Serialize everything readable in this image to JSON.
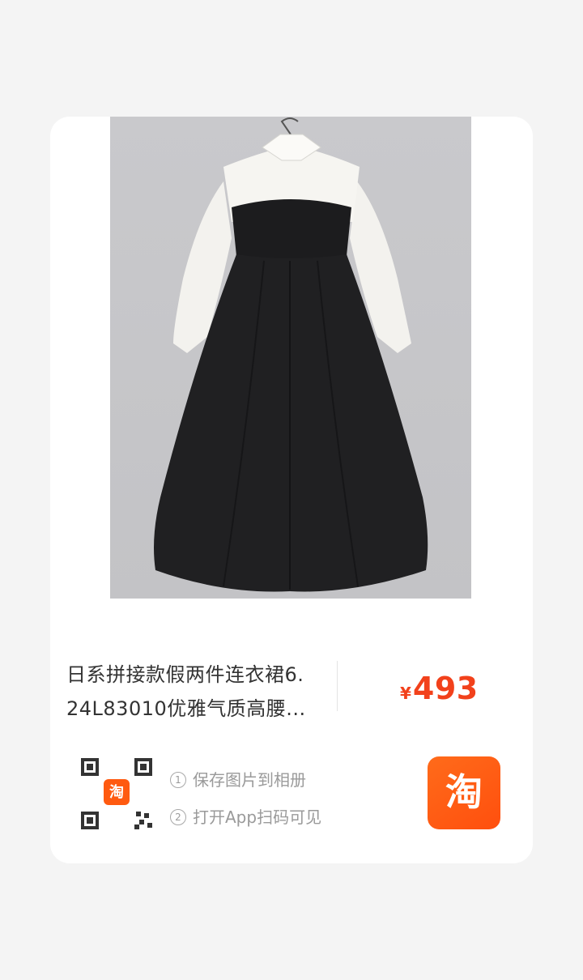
{
  "product": {
    "title_line1": "日系拼接款假两件连衣裙6.",
    "title_line2": "24L83010优雅气质高腰...",
    "price_symbol": "¥",
    "price_value": "493",
    "price_color": "#f2411b"
  },
  "share": {
    "step1_num": "1",
    "step1_text": "保存图片到相册",
    "step2_num": "2",
    "step2_text": "打开App扫码可见",
    "qr_badge_text": "淘",
    "app_logo_text": "淘",
    "app_logo_color": "#ff5a10"
  },
  "icons": {
    "qr": "qr-code-icon",
    "app": "taobao-logo-icon"
  }
}
